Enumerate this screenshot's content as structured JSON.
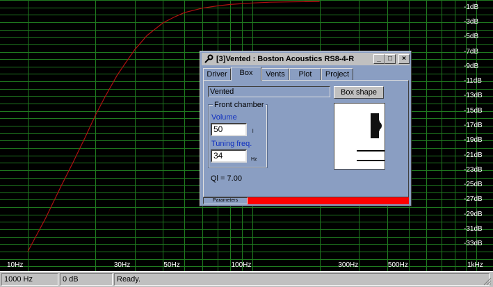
{
  "plot": {
    "db_labels": [
      "-1dB",
      "-3dB",
      "-5dB",
      "-7dB",
      "-9dB",
      "-11dB",
      "-13dB",
      "-15dB",
      "-17dB",
      "-19dB",
      "-21dB",
      "-23dB",
      "-25dB",
      "-27dB",
      "-29dB",
      "-31dB",
      "-33dB"
    ],
    "freq_labels": [
      "10Hz",
      "30Hz",
      "50Hz",
      "100Hz",
      "300Hz",
      "500Hz",
      "1kHz"
    ],
    "grid_color": "#1f7a1f",
    "curve_color": "#b01010"
  },
  "chart_data": {
    "type": "line",
    "x_scale": "log",
    "xlim": [
      10,
      1000
    ],
    "ylim": [
      -34,
      0
    ],
    "series": [
      {
        "x": [
          10,
          12,
          14,
          16,
          18,
          20,
          22,
          25,
          28,
          30,
          34,
          40,
          45,
          50,
          60,
          70,
          80,
          100,
          120,
          150,
          200
        ],
        "y": [
          -34,
          -29.5,
          -25.3,
          -21.8,
          -18.6,
          -15.6,
          -13.2,
          -10.2,
          -8,
          -6.7,
          -4.8,
          -3.1,
          -2.3,
          -1.7,
          -1.1,
          -0.8,
          -0.6,
          -0.4,
          -0.3,
          -0.25,
          -0.2
        ]
      }
    ]
  },
  "dialog": {
    "title": "[3]Vented : Boston Acoustics RS8-4-R",
    "minimize": "_",
    "maximize": "□",
    "close": "×",
    "tabs": [
      "Driver",
      "Box",
      "Vents",
      "Plot",
      "Project"
    ],
    "active_tab": "Box",
    "box_type": "Vented",
    "box_shape_button": "Box shape",
    "front_chamber": {
      "legend": "Front chamber",
      "volume_label": "Volume",
      "volume_value": "50",
      "volume_unit": "l",
      "tuning_label": "Tuning freq.",
      "tuning_value": "34",
      "tuning_unit": "Hz"
    },
    "ql": "Ql = 7.00",
    "progress_label": "Parameters",
    "progress_color": "#ff0000",
    "progress_fraction": 1.0
  },
  "status": {
    "frequency": "1000 Hz",
    "level": "0 dB",
    "state": "Ready."
  }
}
